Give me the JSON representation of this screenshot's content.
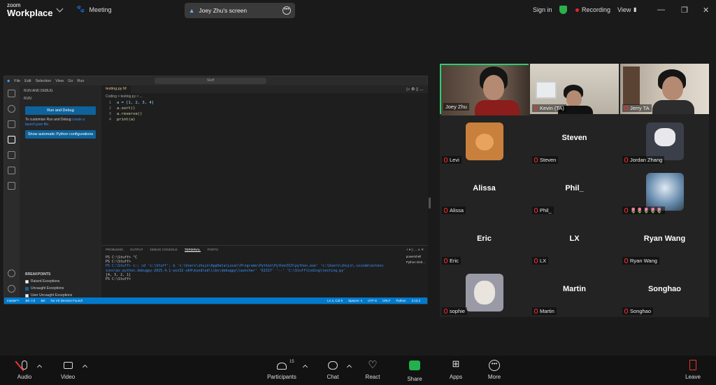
{
  "topbar": {
    "app_small": "zoom",
    "app_name": "Workplace",
    "meeting_label": "Meeting",
    "screen_share_label": "Joey Zhu's screen",
    "sign_in": "Sign in",
    "recording": "Recording",
    "view": "View"
  },
  "vscode": {
    "menu": [
      "File",
      "Edit",
      "Selection",
      "View",
      "Go",
      "Run"
    ],
    "search": "Stuff",
    "sidebar_title": "RUN AND DEBUG",
    "run_section": "RUN",
    "run_debug_button": "Run and Debug",
    "customize_text": "To customize Run and Debug",
    "customize_link": "create a launch.json file.",
    "show_configs_button": "Show automatic Python configurations",
    "breakpoints_title": "BREAKPOINTS",
    "breakpoints": [
      {
        "label": "Raised Exceptions",
        "checked": false
      },
      {
        "label": "Uncaught Exceptions",
        "checked": true
      },
      {
        "label": "User Uncaught Exceptions",
        "checked": false
      }
    ],
    "tab": "testing.py M",
    "breadcrumb": "Coding > testing.py > ...",
    "code_lines": [
      {
        "n": "1",
        "text": "a = [1, 2, 3, 4]"
      },
      {
        "n": "2",
        "text": "a.sort()"
      },
      {
        "n": "3",
        "text": "a.reverse()"
      },
      {
        "n": "4",
        "text": "print(a)"
      }
    ],
    "panel_tabs": [
      "PROBLEMS",
      "OUTPUT",
      "DEBUG CONSOLE",
      "TERMINAL",
      "PORTS"
    ],
    "terminal_lines": [
      "PS C:\\Stuff> ^C",
      "PS C:\\Stuff>",
      "PS C:\\Stuff> c:; cd 'c:\\Stuff'; & 'c:\\Users\\zhujo\\AppData\\Local\\Programs\\Python\\Python313\\python.exe' 'c:\\Users\\zhujo\\.vscode\\extensions\\ms-python.debugpy-2025.4.1-win32-x64\\bundled\\libs\\debugpy\\launcher' '61317' '--' 'C:\\Stuff\\Coding\\testing.py'",
      "[4, 3, 2, 1]",
      "PS C:\\Stuff>"
    ],
    "terminal_list": [
      "powershell",
      "Python Deb..."
    ],
    "status_left": [
      "master*+",
      "⊗0 ⚠0",
      "⊗0",
      "No VS Devices Found!"
    ],
    "status_right": [
      "Ln 4, Col 9",
      "Spaces: 4",
      "UTF-8",
      "CRLF",
      "Python",
      "3.13.2"
    ]
  },
  "participants": [
    {
      "name": "Joey Zhu",
      "type": "video",
      "active": true
    },
    {
      "name": "Kevin (TA)",
      "type": "video"
    },
    {
      "name": "Jerry TA",
      "type": "video"
    },
    {
      "name": "Levi",
      "type": "avatar",
      "color": "#c9803c"
    },
    {
      "name": "Steven",
      "type": "text",
      "big": "Steven"
    },
    {
      "name": "Jordan Zhang",
      "type": "avatar",
      "color": "#3b3f4a"
    },
    {
      "name": "Alissa",
      "type": "text",
      "big": "Alissa"
    },
    {
      "name": "Phil_",
      "type": "text",
      "big": "Phil_"
    },
    {
      "name": "🌷🌷🌷🌷🌷",
      "type": "avatar",
      "color": "#6c8fb0"
    },
    {
      "name": "Eric",
      "type": "text",
      "big": "Eric"
    },
    {
      "name": "LX",
      "type": "text",
      "big": "LX"
    },
    {
      "name": "Ryan Wang",
      "type": "text",
      "big": "Ryan Wang"
    },
    {
      "name": "sophie",
      "type": "avatar",
      "color": "#9a9aa6"
    },
    {
      "name": "Martin",
      "type": "text",
      "big": "Martin"
    },
    {
      "name": "Songhao",
      "type": "text",
      "big": "Songhao"
    }
  ],
  "bottombar": {
    "audio": "Audio",
    "video": "Video",
    "participants": "Participants",
    "participants_count": "15",
    "chat": "Chat",
    "react": "React",
    "share": "Share",
    "apps": "Apps",
    "more": "More",
    "leave": "Leave"
  },
  "colors": {
    "accent": "#007acc",
    "share_green": "#23b14d",
    "active_border": "#2ecc71",
    "mute_red": "#e33333"
  }
}
